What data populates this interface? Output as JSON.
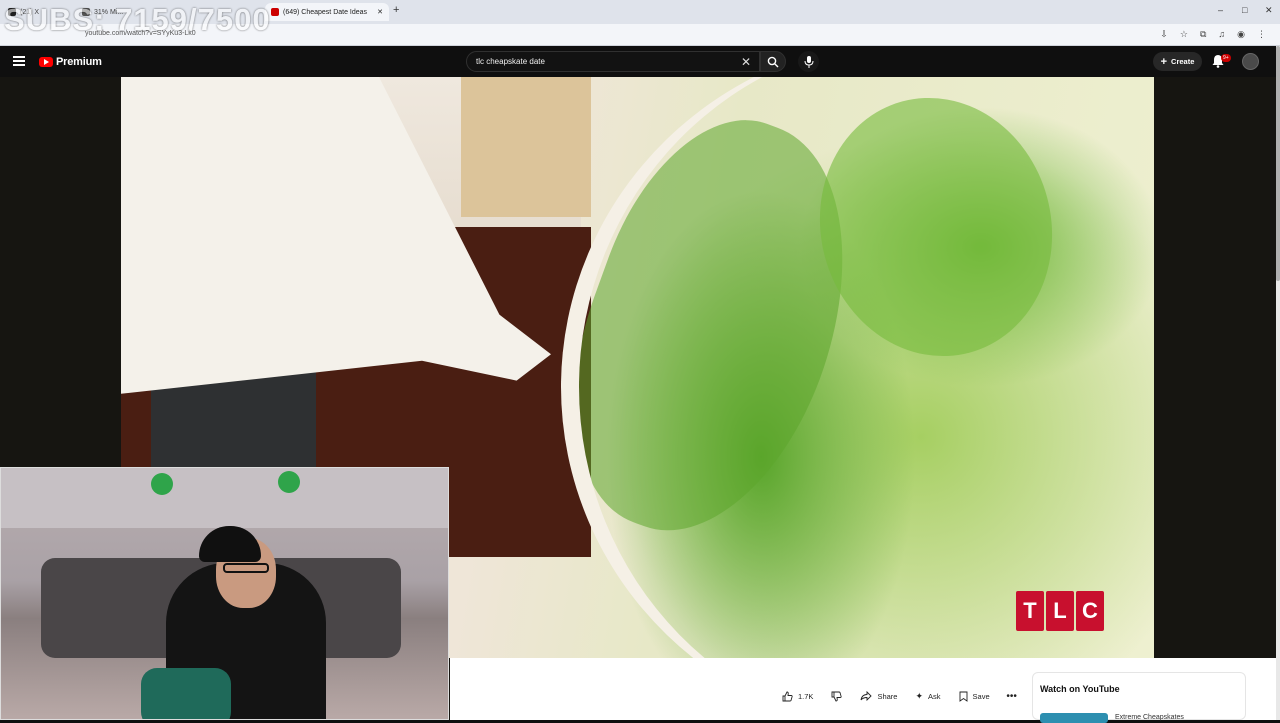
{
  "overlay": {
    "subs_counter": "SUBS: 7159/7500"
  },
  "browser": {
    "tabs": [
      {
        "label": "(21) X"
      },
      {
        "label": "31% Mi..."
      },
      {
        "label": "(649) Cheapest Date Ideas"
      }
    ],
    "url": "youtube.com/watch?v=SYyKu3-Lk0",
    "new_tab": "+",
    "window_controls": [
      "–",
      "□",
      "✕"
    ]
  },
  "youtube": {
    "logo_text": "Premium",
    "search": {
      "query": "tlc cheapskate date"
    },
    "create_label": "Create",
    "notification_badge": "9+"
  },
  "video": {
    "watermark": [
      "T",
      "L",
      "C"
    ]
  },
  "actions": {
    "like_count": "1.7K",
    "share_label": "Share",
    "ask_label": "Ask",
    "save_label": "Save"
  },
  "sidebar": {
    "watch_on_youtube": "Watch on YouTube",
    "next_title": "Extreme Cheapskates"
  },
  "colors": {
    "brand_red": "#ff0000",
    "tlc_red": "#c8102e"
  }
}
